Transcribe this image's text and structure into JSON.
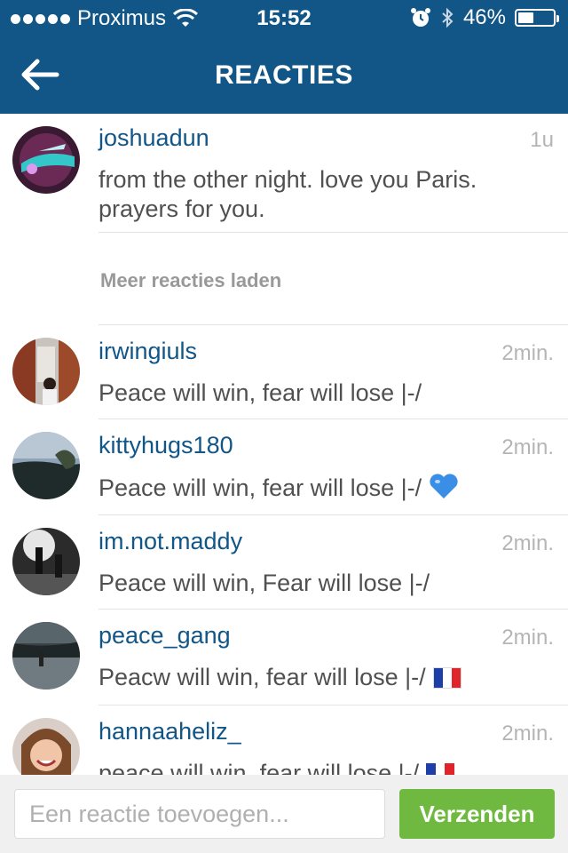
{
  "status_bar": {
    "carrier": "Proximus",
    "time": "15:52",
    "battery_percent": "46%",
    "battery_level": 0.46,
    "signal_bars": 5
  },
  "nav": {
    "title": "REACTIES",
    "back_icon": "arrow-left-icon"
  },
  "caption": {
    "username": "joshuadun",
    "time": "1u",
    "text": "from the other night. love you Paris. prayers for you."
  },
  "load_more_label": "Meer reacties laden",
  "comments": [
    {
      "username": "irwingiuls",
      "time": "2min.",
      "text": "Peace will win, fear will lose |-/",
      "emoji": ""
    },
    {
      "username": "kittyhugs180",
      "time": "2min.",
      "text": "Peace will win, fear will lose |-/",
      "emoji": "blue-heart-icon"
    },
    {
      "username": "im.not.maddy",
      "time": "2min.",
      "text": "Peace will win, Fear will lose |-/",
      "emoji": ""
    },
    {
      "username": "peace_gang",
      "time": "2min.",
      "text": "Peacw will win, fear will lose |-/",
      "emoji": "french-flag-icon"
    },
    {
      "username": "hannaaheliz_",
      "time": "2min.",
      "text": "peace will win, fear will lose |-/",
      "emoji": "french-flag-icon"
    }
  ],
  "composer": {
    "placeholder": "Een reactie toevoegen...",
    "send_label": "Verzenden"
  },
  "colors": {
    "header": "#125688",
    "username": "#125688",
    "send_button": "#70b941"
  }
}
